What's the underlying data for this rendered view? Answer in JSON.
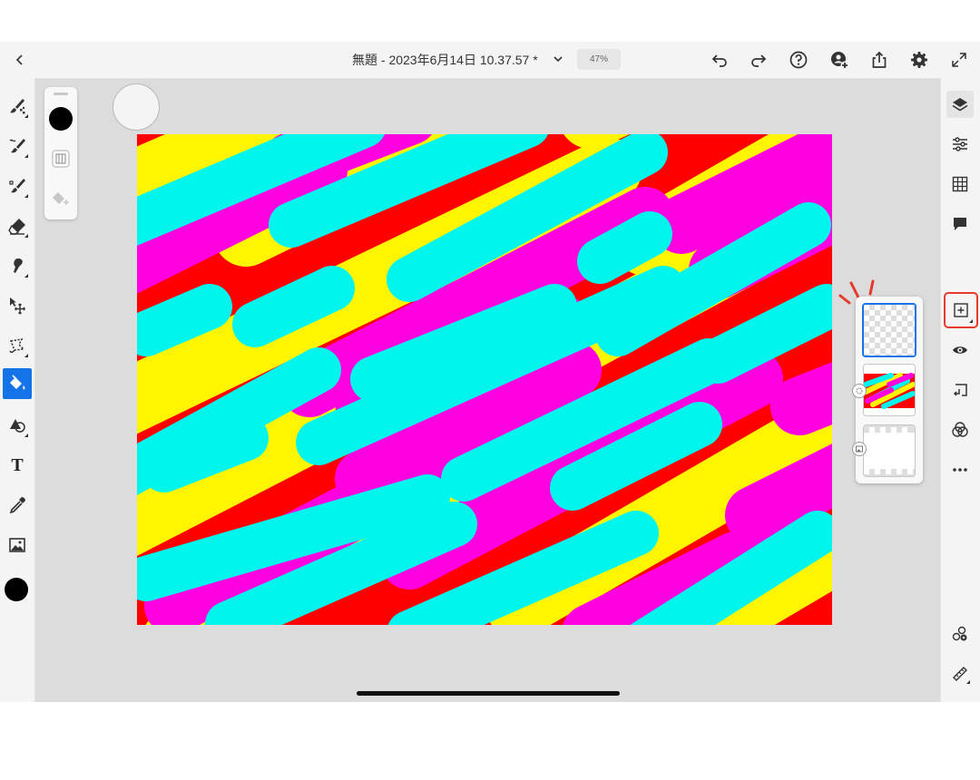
{
  "topbar": {
    "title": "無題 - 2023年6月14日 10.37.57 *",
    "zoom": "47%"
  },
  "icons": {
    "back": "chevron-left-icon",
    "undo": "undo-icon",
    "redo": "redo-icon",
    "help": "help-icon",
    "invite": "add-person-icon",
    "share": "share-icon",
    "settings": "gear-icon",
    "fullscreen": "expand-icon"
  },
  "left_tools": [
    "pixel-brush",
    "live-brush",
    "vector-brush",
    "eraser",
    "smudge",
    "transform",
    "selection",
    "fill",
    "shape",
    "text",
    "eyedropper",
    "image"
  ],
  "active_tool": "fill",
  "text_tool_glyph": "T",
  "current_color": "#000000",
  "right_tools": [
    "layers",
    "properties",
    "grid",
    "comments",
    "add-layer",
    "visibility",
    "merge-down",
    "blend-mode",
    "more",
    "adjustments",
    "ruler"
  ],
  "highlighted_tool": "add-layer",
  "canvas_colors": {
    "red": "#ff0000",
    "yellow": "#fff500",
    "cyan": "#00f5ec",
    "magenta": "#ff00e0"
  },
  "layers": [
    {
      "type": "empty-pixel",
      "selected": true
    },
    {
      "type": "painted-pixel",
      "selected": false
    },
    {
      "type": "background",
      "selected": false
    }
  ],
  "accent": "#1473e6",
  "highlight_color": "#e53b2c"
}
